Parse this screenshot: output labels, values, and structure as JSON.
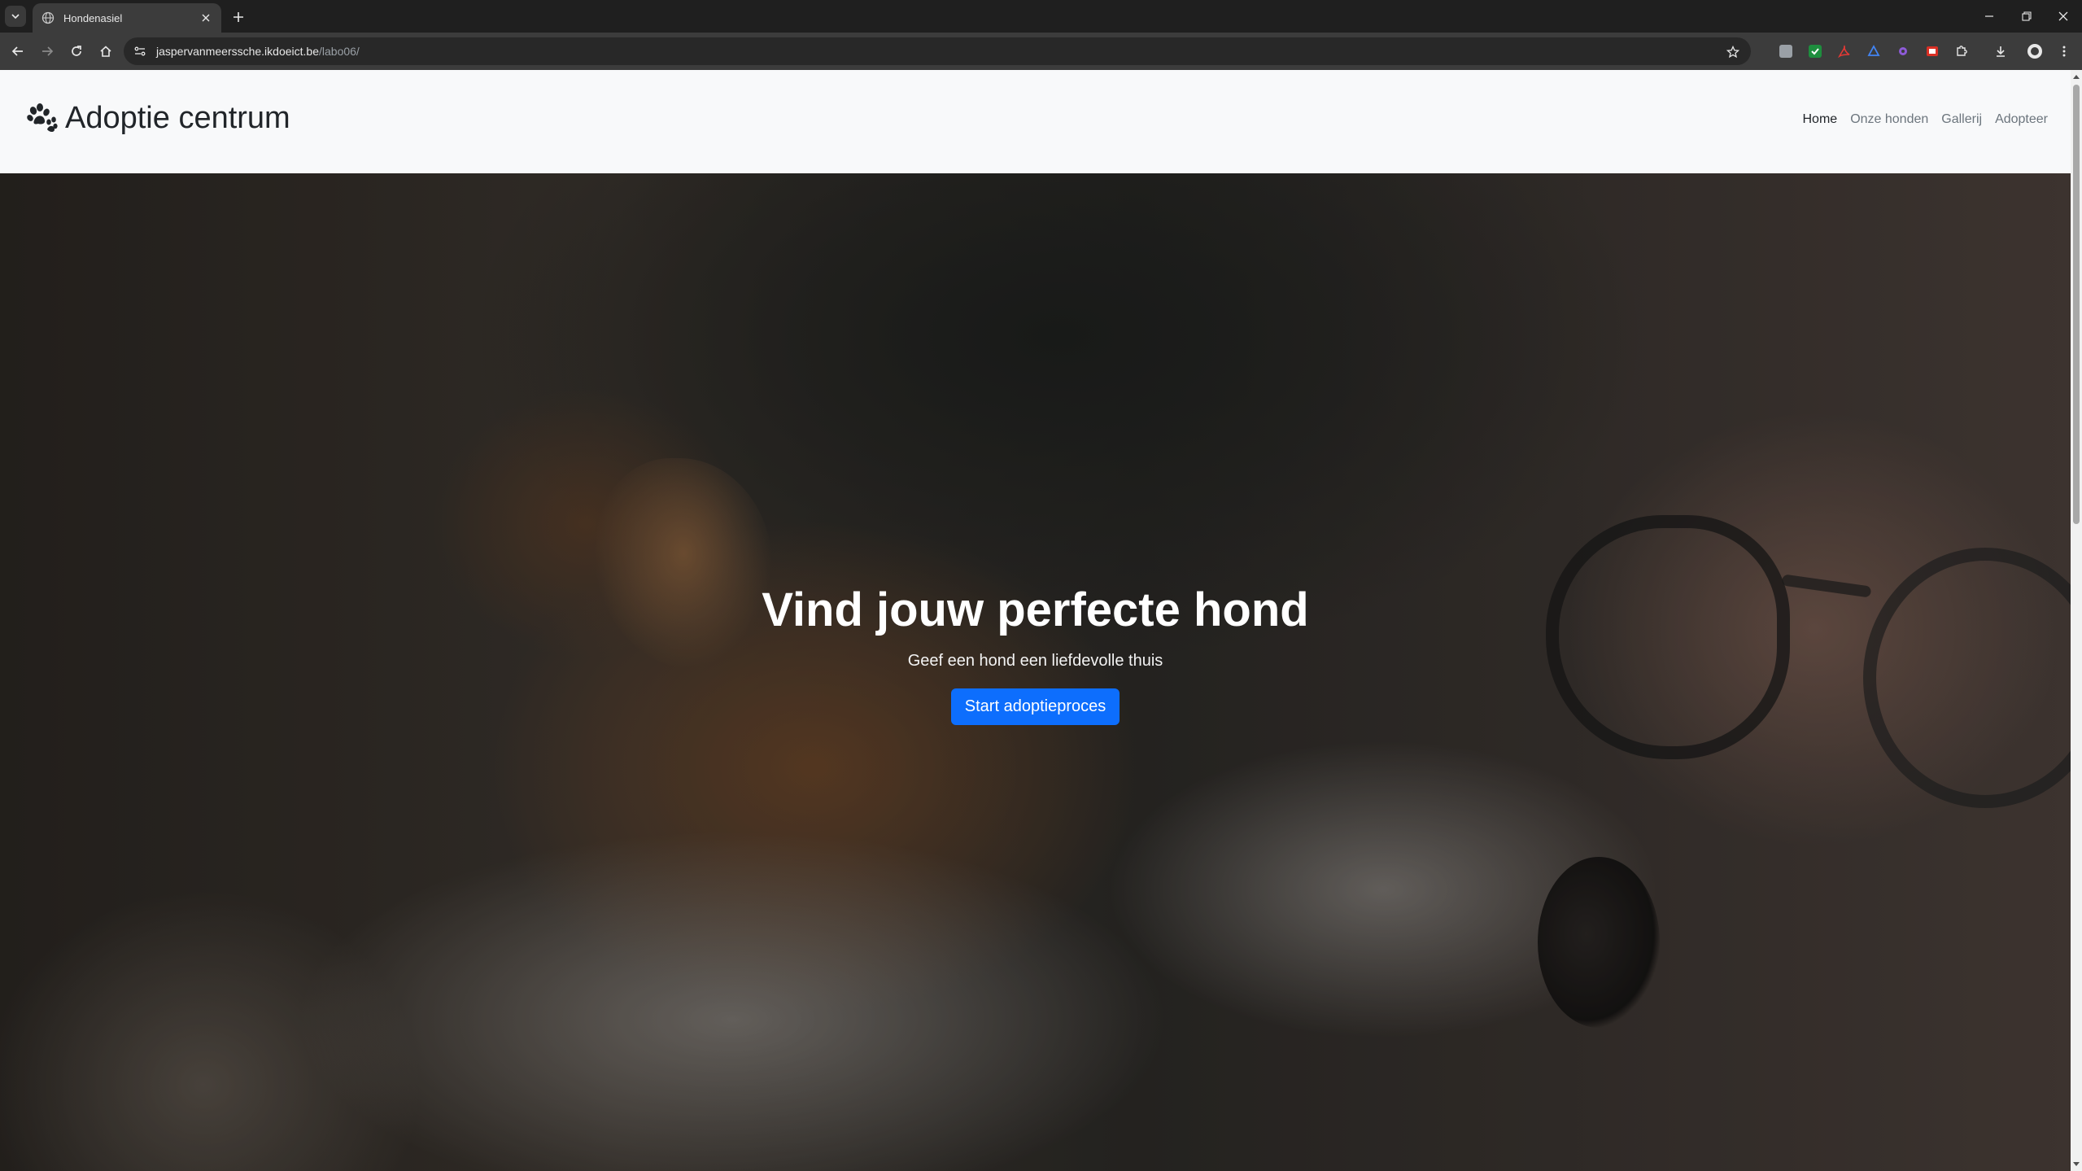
{
  "browser": {
    "tab_title": "Hondenasiel",
    "url_host": "jaspervanmeerssche.ikdoeict.be",
    "url_path": "/labo06/"
  },
  "site": {
    "brand": "Adoptie centrum",
    "nav": [
      "Home",
      "Onze honden",
      "Gallerij",
      "Adopteer"
    ],
    "active_nav": "Home"
  },
  "hero": {
    "title": "Vind jouw perfecte hond",
    "subtitle": "Geef een hond een liefdevolle thuis",
    "button": "Start adoptieproces",
    "button_color": "#0d6efd"
  },
  "icons": {
    "brand": "paw-icon",
    "extensions": [
      "extension-gray",
      "extension-green-check",
      "extension-pdf-red",
      "extension-blue-drive",
      "extension-purple-gear",
      "extension-red-box",
      "puzzle-icon"
    ]
  }
}
